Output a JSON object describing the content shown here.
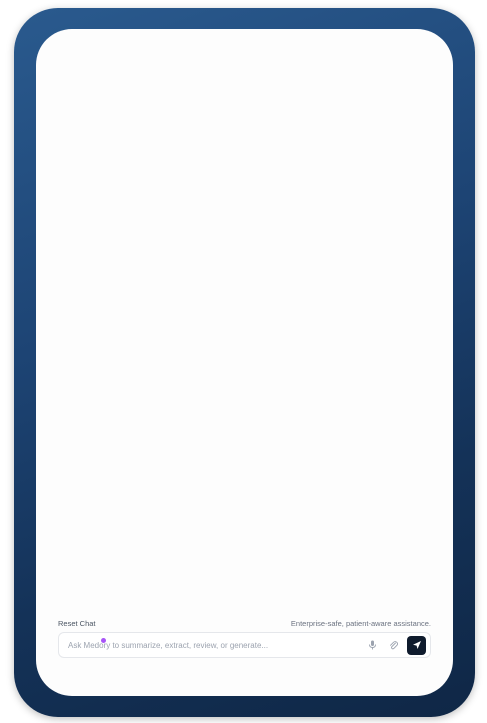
{
  "footer": {
    "reset_label": "Reset Chat",
    "notice": "Enterprise-safe, patient-aware assistance."
  },
  "composer": {
    "placeholder": "Ask Medory to summarize, extract, review, or generate...",
    "value": ""
  },
  "icons": {
    "mic": "microphone-icon",
    "attach": "paperclip-icon",
    "send": "send-icon"
  },
  "colors": {
    "frame_accent": "#1d4474",
    "send_button": "#0f1b2d",
    "cursor_accent": "#a855f7"
  }
}
